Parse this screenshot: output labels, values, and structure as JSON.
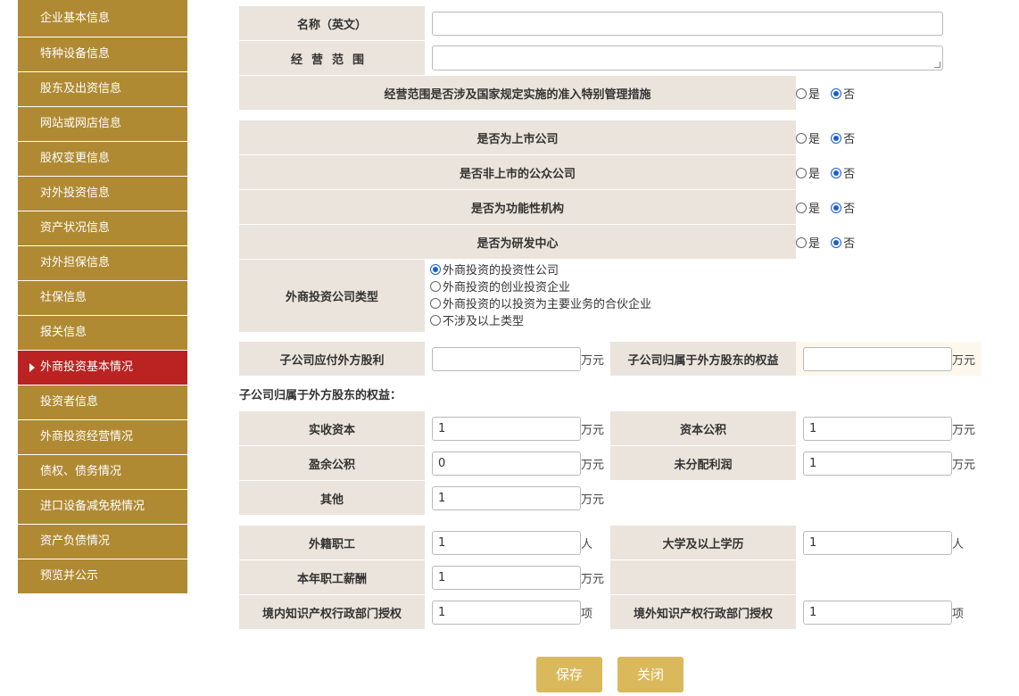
{
  "sidebar": {
    "items": [
      {
        "label": "企业基本信息"
      },
      {
        "label": "特种设备信息"
      },
      {
        "label": "股东及出资信息"
      },
      {
        "label": "网站或网店信息"
      },
      {
        "label": "股权变更信息"
      },
      {
        "label": "对外投资信息"
      },
      {
        "label": "资产状况信息"
      },
      {
        "label": "对外担保信息"
      },
      {
        "label": "社保信息"
      },
      {
        "label": "报关信息"
      },
      {
        "label": "外商投资基本情况",
        "active": true
      },
      {
        "label": "投资者信息"
      },
      {
        "label": "外商投资经营情况"
      },
      {
        "label": "债权、债务情况"
      },
      {
        "label": "进口设备减免税情况"
      },
      {
        "label": "资产负债情况"
      },
      {
        "label": "预览并公示"
      }
    ]
  },
  "form": {
    "name_en": {
      "label": "名称（英文）",
      "value": ""
    },
    "scope": {
      "label": "经营范围",
      "value": ""
    },
    "yes": "是",
    "no": "否",
    "special_measures": {
      "label": "经营范围是否涉及国家规定实施的准入特别管理措施",
      "selected": "否"
    },
    "listed": {
      "label": "是否为上市公司",
      "selected": "否"
    },
    "public_non_listed": {
      "label": "是否非上市的公众公司",
      "selected": "否"
    },
    "functional": {
      "label": "是否为功能性机构",
      "selected": "否"
    },
    "rnd_center": {
      "label": "是否为研发中心",
      "selected": "否"
    },
    "company_type": {
      "label": "外商投资公司类型",
      "options": [
        "外商投资的投资性公司",
        "外商投资的创业投资企业",
        "外商投资的以投资为主要业务的合伙企业",
        "不涉及以上类型"
      ],
      "selected": "外商投资的投资性公司"
    },
    "sub_dividend": {
      "label": "子公司应付外方股利",
      "value": "",
      "unit": "万元"
    },
    "sub_equity": {
      "label": "子公司归属于外方股东的权益",
      "value": "",
      "unit": "万元"
    },
    "sub_equity_heading": "子公司归属于外方股东的权益：",
    "paid_capital": {
      "label": "实收资本",
      "value": "1",
      "unit": "万元"
    },
    "capital_reserve": {
      "label": "资本公积",
      "value": "1",
      "unit": "万元"
    },
    "surplus_reserve": {
      "label": "盈余公积",
      "value": "0",
      "unit": "万元"
    },
    "undistributed_profit": {
      "label": "未分配利润",
      "value": "1",
      "unit": "万元"
    },
    "other": {
      "label": "其他",
      "value": "1",
      "unit": "万元"
    },
    "foreign_staff": {
      "label": "外籍职工",
      "value": "1",
      "unit": "人"
    },
    "college_staff": {
      "label": "大学及以上学历",
      "value": "1",
      "unit": "人"
    },
    "salary": {
      "label": "本年职工薪酬",
      "value": "1",
      "unit": "万元"
    },
    "ip_domestic": {
      "label": "境内知识产权行政部门授权",
      "value": "1",
      "unit": "项"
    },
    "ip_foreign": {
      "label": "境外知识产权行政部门授权",
      "value": "1",
      "unit": "项"
    }
  },
  "buttons": {
    "save": "保存",
    "close": "关闭"
  },
  "colors": {
    "sidebar": "#b08a33",
    "active": "#bb2222",
    "label_bg": "#ebe4dc",
    "button": "#d9b95c"
  }
}
